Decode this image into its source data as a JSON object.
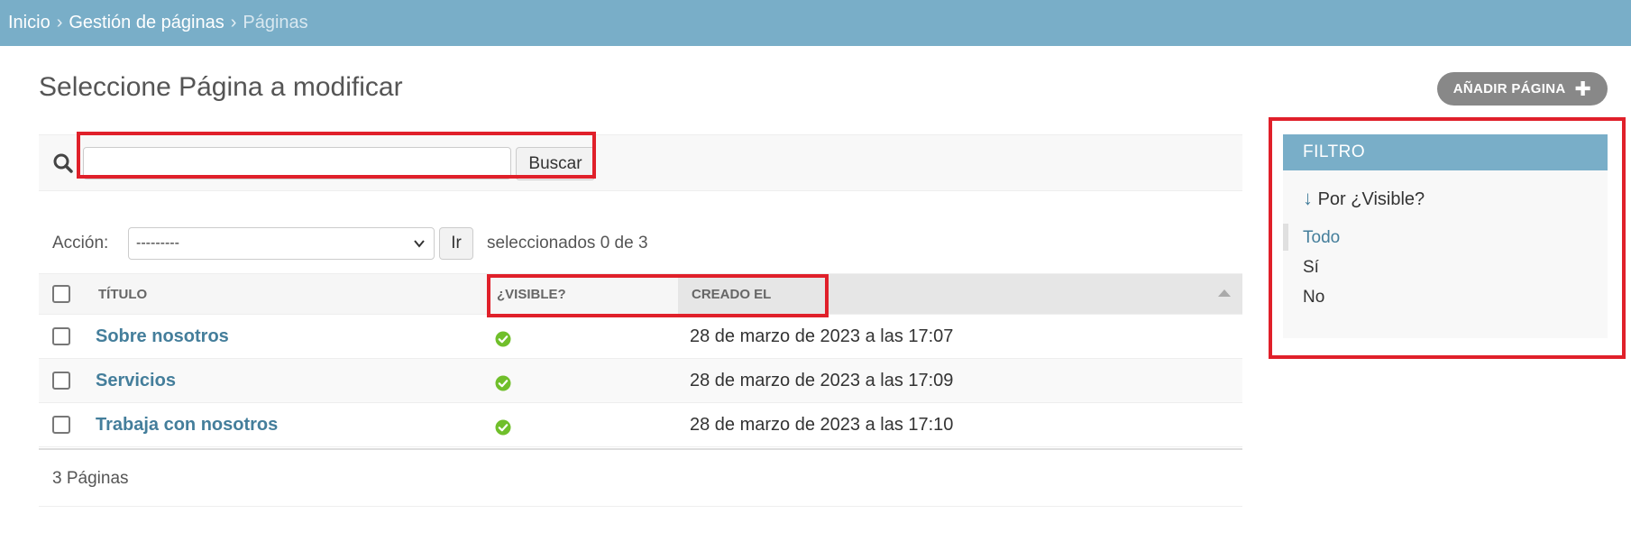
{
  "breadcrumbs": {
    "home": "Inicio",
    "section": "Gestión de páginas",
    "current": "Páginas",
    "separator": "›"
  },
  "page": {
    "title": "Seleccione Página a modificar",
    "add_button": "AÑADIR PÁGINA"
  },
  "search": {
    "value": "",
    "button": "Buscar"
  },
  "actions": {
    "label": "Acción:",
    "selected": "---------",
    "go": "Ir",
    "selection_count": "seleccionados 0 de 3"
  },
  "table": {
    "columns": [
      "TÍTULO",
      "¿VISIBLE?",
      "CREADO EL"
    ],
    "rows": [
      {
        "title": "Sobre nosotros",
        "visible": true,
        "created": "28 de marzo de 2023 a las 17:07"
      },
      {
        "title": "Servicios",
        "visible": true,
        "created": "28 de marzo de 2023 a las 17:09"
      },
      {
        "title": "Trabaja con nosotros",
        "visible": true,
        "created": "28 de marzo de 2023 a las 17:10"
      }
    ],
    "count_label": "3 Páginas"
  },
  "filter": {
    "title": "FILTRO",
    "by_label": "Por ¿Visible?",
    "options": [
      "Todo",
      "Sí",
      "No"
    ],
    "selected": "Todo"
  },
  "colors": {
    "header": "#79aec8",
    "link": "#447e9b",
    "highlight": "#e0202a",
    "check": "#70bf2b"
  }
}
